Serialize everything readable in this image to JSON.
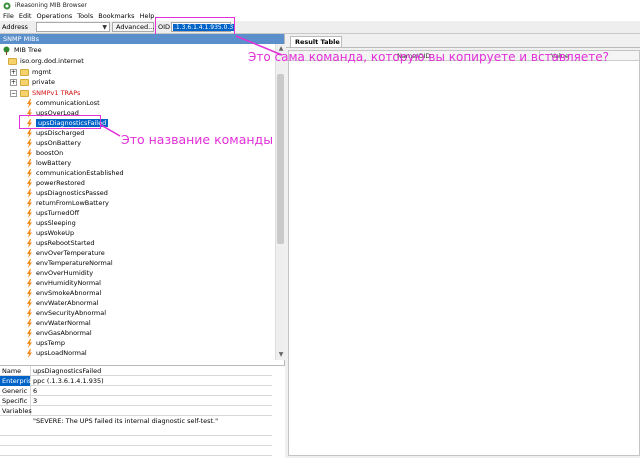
{
  "window": {
    "title": "iReasoning MIB Browser"
  },
  "menu": [
    "File",
    "Edit",
    "Operations",
    "Tools",
    "Bookmarks",
    "Help"
  ],
  "toolbar": {
    "address_label": "Address",
    "address_value": "",
    "advanced_label": "Advanced...",
    "oid_label": "OID",
    "oid_value": ".1.3.6.1.4.1.935.0.3"
  },
  "left_panel": {
    "header": "SNMP MIBs"
  },
  "tree": {
    "root": "MIB Tree",
    "base": "iso.org.dod.internet",
    "mgmt": "mgmt",
    "private": "private",
    "traps_folder": "SNMPv1 TRAPs",
    "traps": [
      "communicationLost",
      "upsOverLoad",
      "upsDiagnosticsFailed",
      "upsDischarged",
      "upsOnBattery",
      "boostOn",
      "lowBattery",
      "communicationEstablished",
      "powerRestored",
      "upsDiagnosticsPassed",
      "returnFromLowBattery",
      "upsTurnedOff",
      "upsSleeping",
      "upsWokeUp",
      "upsRebootStarted",
      "envOverTemperature",
      "envTemperatureNormal",
      "envOverHumidity",
      "envHumidityNormal",
      "envSmokeAbnormal",
      "envWaterAbnormal",
      "envSecurityAbnormal",
      "envWaterNormal",
      "envGasAbnormal",
      "upsTemp",
      "upsLoadNormal"
    ]
  },
  "properties": {
    "name_label": "Name",
    "name_value": "upsDiagnosticsFailed",
    "enterprise_label": "Enterprise",
    "enterprise_value": "ppc (.1.3.6.1.4.1.935)",
    "generic_label": "Generic",
    "generic_value": "6",
    "specific_label": "Specific",
    "specific_value": "3",
    "variables_label": "Variables",
    "description": "\"SEVERE: The UPS failed its internal diagnostic self-test.\""
  },
  "result_panel": {
    "tab": "Result Table",
    "columns": [
      "Name/OID",
      "Value"
    ]
  },
  "annotations": {
    "oid_note": "Это сама команда, которую вы копируете и вставляете?",
    "name_note": "Это название команды"
  },
  "colors": {
    "annotation": "#e22fd8",
    "selection": "#0063c8",
    "header": "#5b8fcb"
  }
}
